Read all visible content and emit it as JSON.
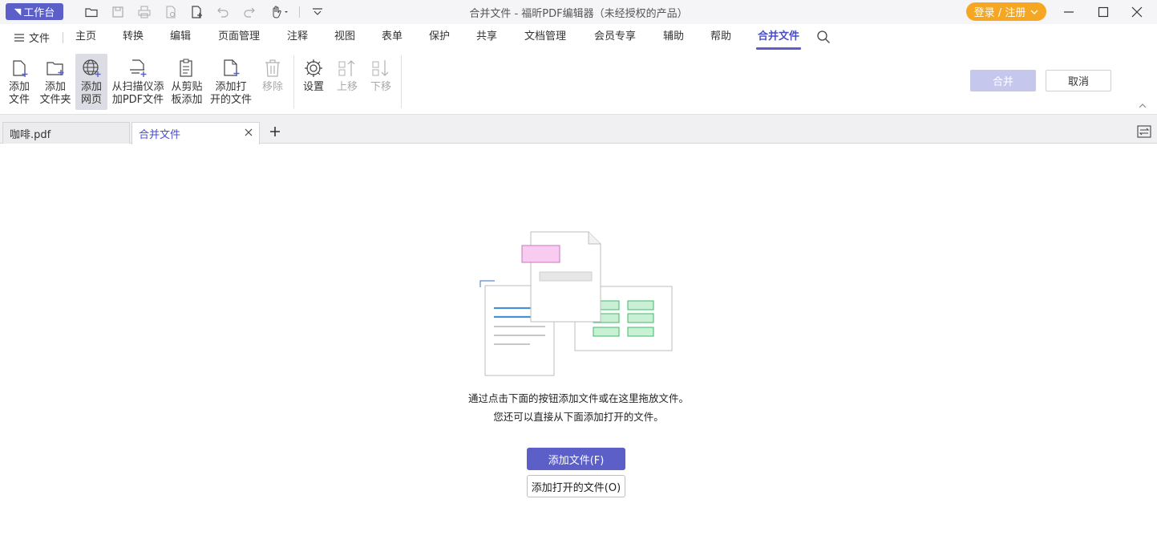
{
  "titlebar": {
    "workbench_label": "工作台",
    "app_title": "合并文件 - 福昕PDF编辑器（未经授权的产品）",
    "login_label": "登录 / 注册"
  },
  "menu": {
    "file_label": "文件",
    "items": [
      "主页",
      "转换",
      "编辑",
      "页面管理",
      "注释",
      "视图",
      "表单",
      "保护",
      "共享",
      "文档管理",
      "会员专享",
      "辅助",
      "帮助",
      "合并文件"
    ],
    "active": "合并文件"
  },
  "ribbon": {
    "add_file": "添加\n文件",
    "add_folder": "添加\n文件夹",
    "add_webpage": "添加\n网页",
    "add_from_scanner": "从扫描仪添\n加PDF文件",
    "add_from_clipboard": "从剪贴\n板添加",
    "add_open_files": "添加打\n开的文件",
    "remove": "移除",
    "settings": "设置",
    "move_up": "上移",
    "move_down": "下移",
    "merge": "合并",
    "cancel": "取消"
  },
  "tabs": [
    {
      "label": "咖啡.pdf"
    },
    {
      "label": "合并文件"
    }
  ],
  "content": {
    "hint_line1": "通过点击下面的按钮添加文件或在这里拖放文件。",
    "hint_line2": "您还可以直接从下面添加打开的文件。",
    "add_file_button": "添加文件(F)",
    "add_open_button": "添加打开的文件(O)"
  },
  "colors": {
    "accent": "#5b5fc7",
    "login": "#f5a623",
    "merge_disabled": "#c5c7ed"
  }
}
